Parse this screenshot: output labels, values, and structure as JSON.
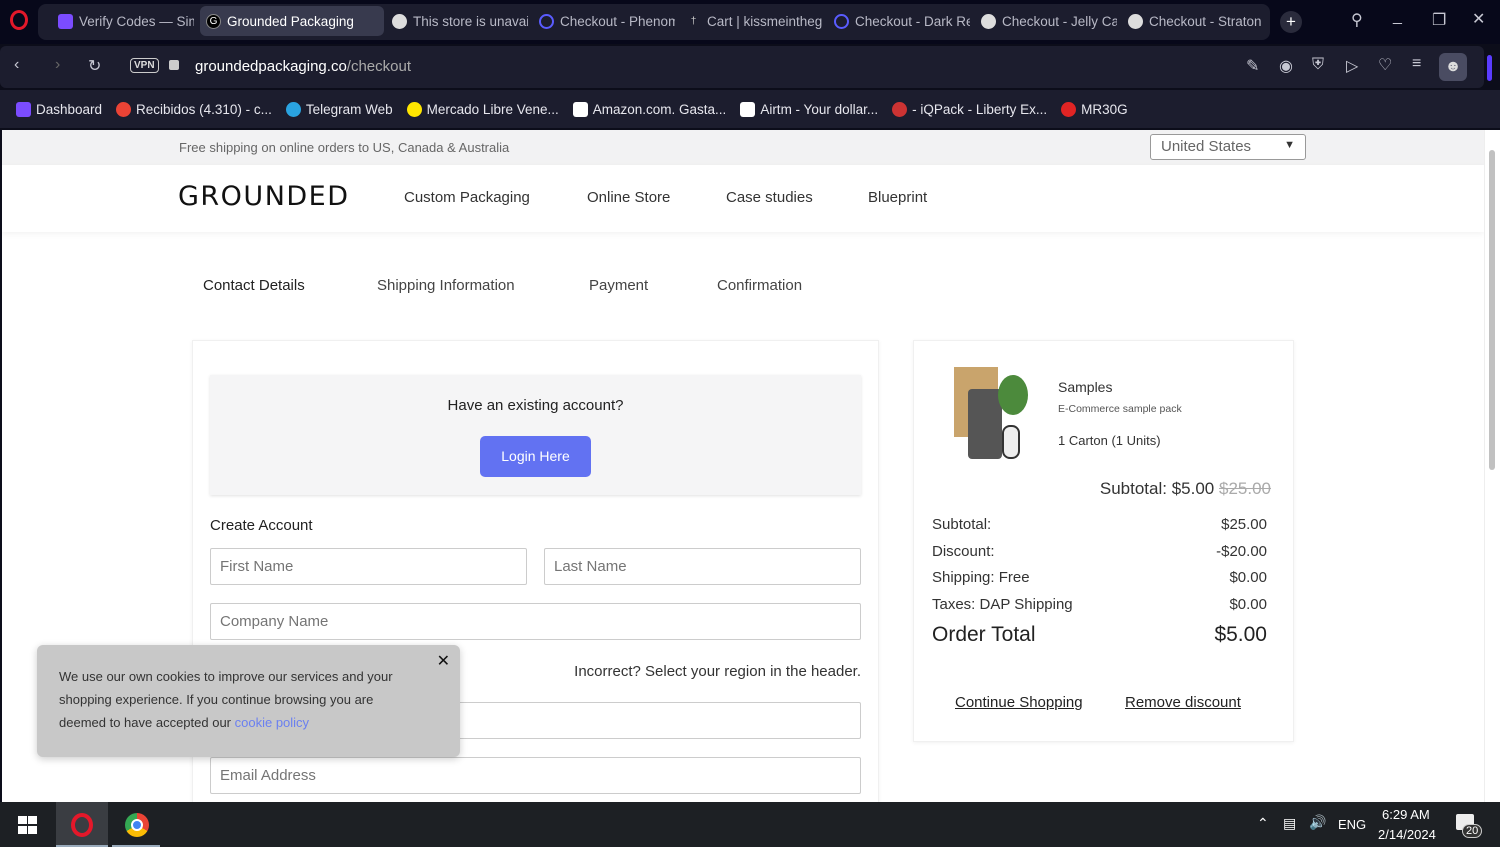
{
  "browser": {
    "tabs": [
      {
        "label": "Verify Codes — Sim",
        "icon": "simplelogin-icon",
        "color": "#7b4cff"
      },
      {
        "label": "Grounded Packaging",
        "icon": "g-icon",
        "active": true
      },
      {
        "label": "This store is unavail",
        "icon": "globe-icon"
      },
      {
        "label": "Checkout - Phenom",
        "icon": "loop-icon",
        "color": "#5a5cff"
      },
      {
        "label": "Cart | kissmeintheg",
        "icon": "cart-icon"
      },
      {
        "label": "Checkout - Dark Re",
        "icon": "loop-icon",
        "color": "#5a5cff"
      },
      {
        "label": "Checkout - Jelly Ca",
        "icon": "globe-icon"
      },
      {
        "label": "Checkout - Straton",
        "icon": "globe-icon"
      }
    ],
    "url_domain": "groundedpackaging.co",
    "url_path": "/checkout",
    "vpn": "VPN",
    "bookmarks": [
      {
        "label": "Dashboard",
        "icon": "simplelogin-icon",
        "color": "#7b4cff"
      },
      {
        "label": "Recibidos (4.310) - c...",
        "icon": "gmail-icon",
        "color": "#ea4335"
      },
      {
        "label": "Telegram Web",
        "icon": "telegram-icon",
        "color": "#2aa3e0"
      },
      {
        "label": "Mercado Libre Vene...",
        "icon": "mercadolibre-icon",
        "color": "#ffe600"
      },
      {
        "label": "Amazon.com. Gasta...",
        "icon": "amazon-icon",
        "color": "#fff"
      },
      {
        "label": "Airtm - Your dollar...",
        "icon": "airtm-icon",
        "color": "#fff"
      },
      {
        "label": "- iQPack - Liberty Ex...",
        "icon": "iqpack-icon",
        "color": "#c33"
      },
      {
        "label": "MR30G",
        "icon": "m-icon",
        "color": "#e02424"
      }
    ]
  },
  "page": {
    "shipping_notice": "Free shipping on online orders to US, Canada & Australia",
    "country": "United States",
    "logo": "GROUNDED",
    "nav": [
      "Custom Packaging",
      "Online Store",
      "Case studies",
      "Blueprint"
    ],
    "steps": [
      "Contact Details",
      "Shipping Information",
      "Payment",
      "Confirmation"
    ],
    "login": {
      "prompt": "Have an existing account?",
      "button": "Login Here"
    },
    "create_account": "Create Account",
    "placeholders": {
      "first": "First Name",
      "last": "Last Name",
      "company": "Company Name",
      "email": "Email Address"
    },
    "region_note": "Incorrect? Select your region in the header.",
    "cookie": {
      "text": "We use our own cookies to improve our services and your shopping experience. If you continue browsing you are deemed to have accepted our ",
      "link": "cookie policy"
    },
    "summary": {
      "product": "Samples",
      "product_sub": "E-Commerce sample pack",
      "qty": "1 Carton (1 Units)",
      "subtotal_label": "Subtotal:",
      "subtotal_new": "$5.00",
      "subtotal_old": "$25.00",
      "rows": [
        {
          "label": "Subtotal:",
          "value": "$25.00"
        },
        {
          "label": "Discount:",
          "value": "-$20.00"
        },
        {
          "label": "Shipping: Free",
          "value": "$0.00"
        },
        {
          "label": "Taxes: DAP Shipping",
          "value": "$0.00"
        }
      ],
      "total_label": "Order Total",
      "total_value": "$5.00",
      "continue": "Continue Shopping",
      "remove": "Remove discount"
    }
  },
  "taskbar": {
    "time": "6:29 AM",
    "date": "2/14/2024",
    "lang": "ENG",
    "notifications": "20"
  }
}
